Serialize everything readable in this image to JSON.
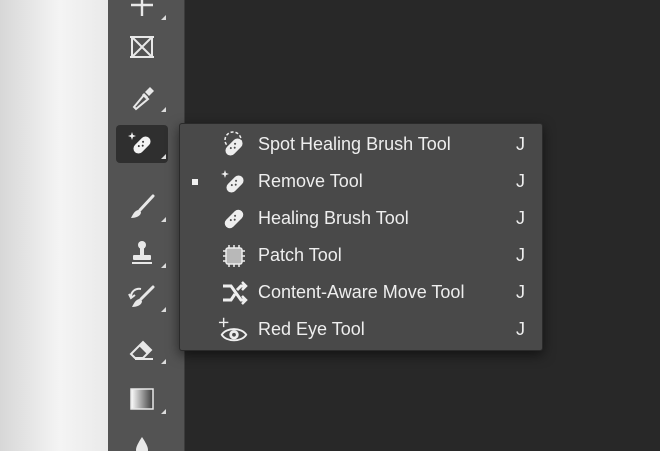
{
  "toolbar": {
    "tools": [
      {
        "name": "move-tool-icon"
      },
      {
        "name": "frame-tool-icon"
      },
      {
        "name": "eyedropper-tool-icon"
      },
      {
        "name": "healing-tools-icon",
        "active": true
      },
      {
        "name": "brush-tool-icon"
      },
      {
        "name": "clone-stamp-tool-icon"
      },
      {
        "name": "history-brush-tool-icon"
      },
      {
        "name": "eraser-tool-icon"
      },
      {
        "name": "gradient-tool-icon"
      },
      {
        "name": "blur-tool-icon"
      }
    ]
  },
  "menu": {
    "items": [
      {
        "label": "Spot Healing Brush Tool",
        "shortcut": "J",
        "icon": "spot-healing-brush-icon",
        "selected": false
      },
      {
        "label": "Remove Tool",
        "shortcut": "J",
        "icon": "remove-tool-icon",
        "selected": true
      },
      {
        "label": "Healing Brush Tool",
        "shortcut": "J",
        "icon": "healing-brush-icon",
        "selected": false
      },
      {
        "label": "Patch Tool",
        "shortcut": "J",
        "icon": "patch-tool-icon",
        "selected": false
      },
      {
        "label": "Content-Aware Move Tool",
        "shortcut": "J",
        "icon": "content-aware-move-icon",
        "selected": false
      },
      {
        "label": "Red Eye Tool",
        "shortcut": "J",
        "icon": "red-eye-tool-icon",
        "selected": false
      }
    ]
  },
  "colors": {
    "toolbar_bg": "#535353",
    "canvas_bg": "#282828",
    "menu_bg": "#494949",
    "text": "#eeeeee"
  }
}
